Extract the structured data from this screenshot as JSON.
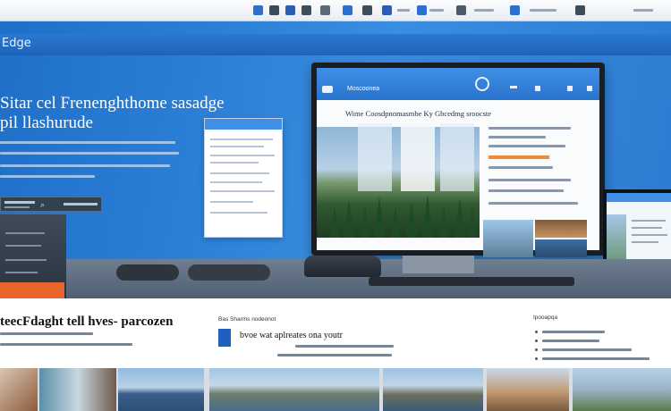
{
  "header": {
    "brand": "Edge",
    "headline": "Sitar cel Frenenghthome sasadge pil llashurude"
  },
  "screen": {
    "brand": "Moscoonea",
    "title": "Wime Coosdpnomasmbe Ky Gbcedmg sroocste"
  },
  "lower": {
    "heading": "teecFdaght tell hves- parcozen",
    "mid_heading": "Bas Sharms nodeonot",
    "mid_title": "bvoe wat aplreates ona youtr",
    "right_heading": "Ipooapqa"
  },
  "colors": {
    "accent_blue": "#2b7fd6",
    "orange": "#e8642a",
    "dark_panel": "#2a3440"
  },
  "icons": [
    "toolbar-home-icon",
    "toolbar-mail-icon",
    "toolbar-settings-icon",
    "search-icon",
    "logo-icon"
  ]
}
